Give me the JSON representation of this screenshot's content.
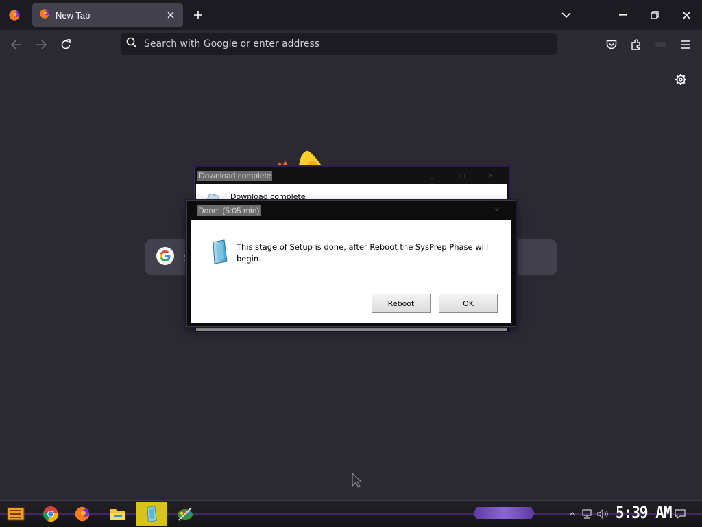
{
  "browser": {
    "tab": {
      "title": "New Tab"
    },
    "urlbar": {
      "placeholder": "Search with Google or enter address"
    }
  },
  "newtab": {
    "search_placeholder": "S"
  },
  "dialog_download": {
    "title": "Download complete",
    "message": "Download complete"
  },
  "dialog_done": {
    "title": "Done! (5:05 min)",
    "message": "This stage of Setup is done, after Reboot the SysPrep Phase will begin.",
    "reboot_label": "Reboot",
    "ok_label": "OK"
  },
  "taskbar": {
    "clock": "5:39 AM",
    "pinned": [
      "start-button",
      "chrome-icon",
      "firefox-icon",
      "file-explorer-icon",
      "setup-app-icon",
      "paint-app-icon"
    ],
    "accent": "#d8c21c"
  },
  "colors": {
    "page_background": "#2b2a33",
    "chrome_dark": "#1c1b22",
    "tab_active": "#42414d"
  }
}
